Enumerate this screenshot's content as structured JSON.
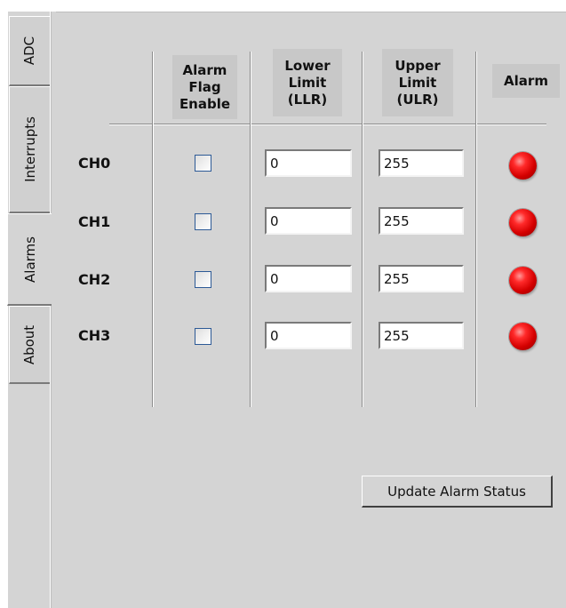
{
  "tabs": [
    {
      "label": "ADC",
      "active": false
    },
    {
      "label": "Interrupts",
      "active": false
    },
    {
      "label": "Alarms",
      "active": true
    },
    {
      "label": "About",
      "active": false
    }
  ],
  "table": {
    "headers": {
      "alarm_flag_enable": "Alarm\nFlag\nEnable",
      "lower_limit": "Lower\nLimit\n(LLR)",
      "upper_limit": "Upper\nLimit\n(ULR)",
      "alarm": "Alarm"
    },
    "rows": [
      {
        "channel": "CH0",
        "flag_enabled": false,
        "llr": "0",
        "ulr": "255",
        "alarm_active": true
      },
      {
        "channel": "CH1",
        "flag_enabled": false,
        "llr": "0",
        "ulr": "255",
        "alarm_active": true
      },
      {
        "channel": "CH2",
        "flag_enabled": false,
        "llr": "0",
        "ulr": "255",
        "alarm_active": true
      },
      {
        "channel": "CH3",
        "flag_enabled": false,
        "llr": "0",
        "ulr": "255",
        "alarm_active": true
      }
    ]
  },
  "buttons": {
    "update_alarm_status": "Update Alarm Status"
  },
  "colors": {
    "background": "#d4d4d4",
    "led_on": "#e00000",
    "checkbox_border": "#2d5a96"
  }
}
